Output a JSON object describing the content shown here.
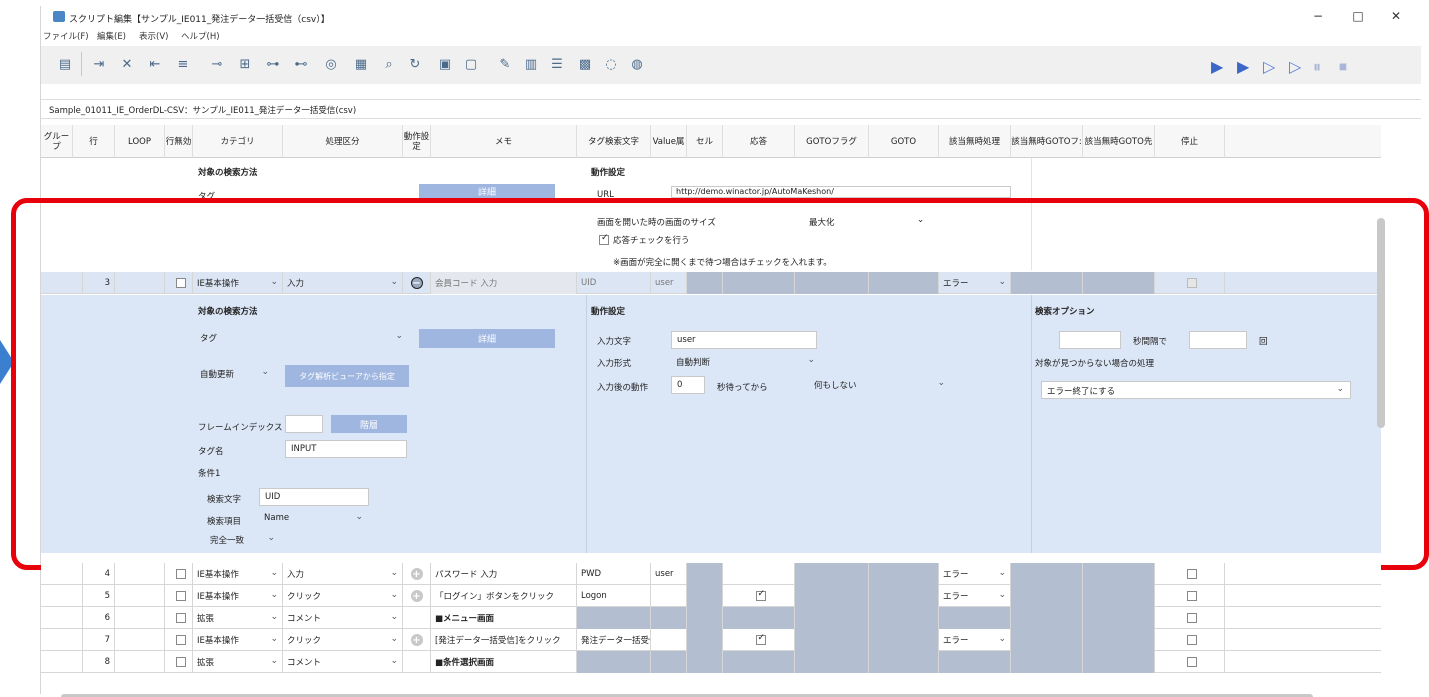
{
  "window": {
    "title": "スクリプト編集【サンプル_IE011_発注データ一括受信（csv）】",
    "minimize": "−",
    "maximize": "□",
    "close": "✕"
  },
  "menu": [
    "ファイル(F)",
    "編集(E)",
    "表示(V)",
    "ヘルプ(H)"
  ],
  "path": "Sample_01011_IE_OrderDL-CSV：サンプル_IE011_発注データ一括受信(csv)",
  "columns": {
    "group": "グループ",
    "row": "行",
    "loop": "LOOP",
    "disabled": "行無効",
    "category": "カテゴリ",
    "process": "処理区分",
    "action_settings": "動作設定",
    "memo": "メモ",
    "tag_search": "タグ検索文字",
    "value_attr": "Value属",
    "cell": "セル",
    "response": "応答",
    "goto_flag": "GOTOフラグ",
    "goto": "GOTO",
    "notfound": "該当無時処理",
    "notfound_goto_flag": "該当無時GOTOフ:",
    "notfound_goto_dest": "該当無時GOTO先",
    "stop": "停止"
  },
  "top_section": {
    "search_method": "対象の検索方法",
    "action_settings": "動作設定",
    "tag_value": "タグ",
    "url_label": "URL",
    "url_value": "http://demo.winactor.jp/AutoMaKeshon/",
    "size_label": "画面を開いた時の画面のサイズ",
    "size_value": "最大化",
    "response_check": "応答チェックを行う",
    "note": "※画面が完全に開くまで待つ場合はチェックを入れます。",
    "detail": "詳細"
  },
  "row3": {
    "num": "3",
    "category": "IE基本操作",
    "process": "入力",
    "memo": "会員コード 入力",
    "tag": "UID",
    "value": "user",
    "notfound": "エラー"
  },
  "detail": {
    "search_method": "対象の検索方法",
    "tag_value": "タグ",
    "detail_button": "詳細",
    "auto_update": "自動更新",
    "tag_viewer": "タグ解析ビューアから指定",
    "frame_index": "フレームインデックス",
    "hierarchy": "階層",
    "tag_name_label": "タグ名",
    "tag_name_value": "INPUT",
    "condition": "条件1",
    "search_text_label": "検索文字",
    "search_text_value": "UID",
    "search_item_label": "検索項目",
    "search_item_value": "Name",
    "match": "完全一致",
    "action_settings": "動作設定",
    "input_text_label": "入力文字",
    "input_text_value": "user",
    "input_format_label": "入力形式",
    "input_format_value": "自動判断",
    "after_label": "入力後の動作",
    "after_wait": "0",
    "after_wait_unit": "秒待ってから",
    "after_value": "何もしない",
    "search_options": "検索オプション",
    "interval_unit": "秒間隔で",
    "times_unit": "回",
    "notfound_label": "対象が見つからない場合の処理",
    "notfound_value": "エラー終了にする"
  },
  "rows": [
    {
      "num": "4",
      "category": "IE基本操作",
      "process": "入力",
      "memo": "パスワード 入力",
      "tag": "PWD",
      "value": "user",
      "response": false,
      "notfound": "エラー"
    },
    {
      "num": "5",
      "category": "IE基本操作",
      "process": "クリック",
      "memo": "「ログイン」ボタンをクリック",
      "tag": "Logon",
      "value": "",
      "response": true,
      "notfound": "エラー"
    },
    {
      "num": "6",
      "category": "拡張",
      "process": "コメント",
      "memo": "■メニュー画面",
      "tag": "",
      "value": "",
      "response": null,
      "notfound": ""
    },
    {
      "num": "7",
      "category": "IE基本操作",
      "process": "クリック",
      "memo": "[発注データ一括受信]をクリック",
      "tag": "発注データ一括受信",
      "value": "",
      "response": true,
      "notfound": "エラー"
    },
    {
      "num": "8",
      "category": "拡張",
      "process": "コメント",
      "memo": "■条件選択画面",
      "tag": "",
      "value": "",
      "response": null,
      "notfound": ""
    }
  ]
}
